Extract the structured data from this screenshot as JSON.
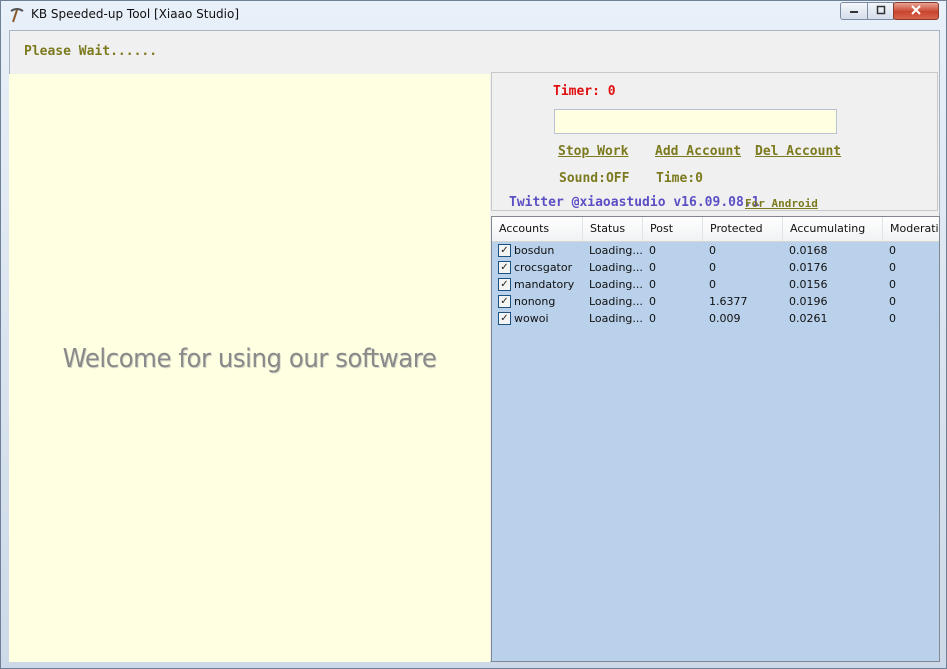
{
  "window": {
    "title": "KB Speeded-up Tool [Xiaao Studio]",
    "app_icon": "pickaxe-icon",
    "controls": {
      "minimize": "minimize-icon",
      "maximize": "maximize-icon",
      "close": "close-icon"
    }
  },
  "status": {
    "text": "Please Wait......"
  },
  "welcome": {
    "text": "Welcome for using our software"
  },
  "controls": {
    "timer_label": "Timer: 0",
    "input_value": "",
    "stop_work": "Stop Work",
    "add_account": "Add Account",
    "del_account": "Del Account",
    "sound": "Sound:OFF",
    "time": "Time:0",
    "twitter": "Twitter @xiaoastudio v16.09.08.1",
    "for_android": "For Android"
  },
  "accounts_table": {
    "columns": [
      "Accounts",
      "Status",
      "Post",
      "Protected",
      "Accumulating",
      "Moderation"
    ],
    "rows": [
      {
        "checked": true,
        "cells": [
          "bosdun",
          "Loading...",
          "0",
          "0",
          "0.0168",
          "0"
        ]
      },
      {
        "checked": true,
        "cells": [
          "crocsgator",
          "Loading...",
          "0",
          "0",
          "0.0176",
          "0"
        ]
      },
      {
        "checked": true,
        "cells": [
          "mandatory",
          "Loading...",
          "0",
          "0",
          "0.0156",
          "0"
        ]
      },
      {
        "checked": true,
        "cells": [
          "nonong",
          "Loading...",
          "0",
          "1.6377",
          "0.0196",
          "0"
        ]
      },
      {
        "checked": true,
        "cells": [
          "wowoi",
          "Loading...",
          "0",
          "0.009",
          "0.0261",
          "0"
        ]
      }
    ]
  },
  "colors": {
    "list_background": "#b9d1ea",
    "welcome_background": "#ffffe1",
    "link_olive": "#7c7a1e",
    "timer_red": "#e01010",
    "twitter_purple": "#5b4fc4"
  }
}
